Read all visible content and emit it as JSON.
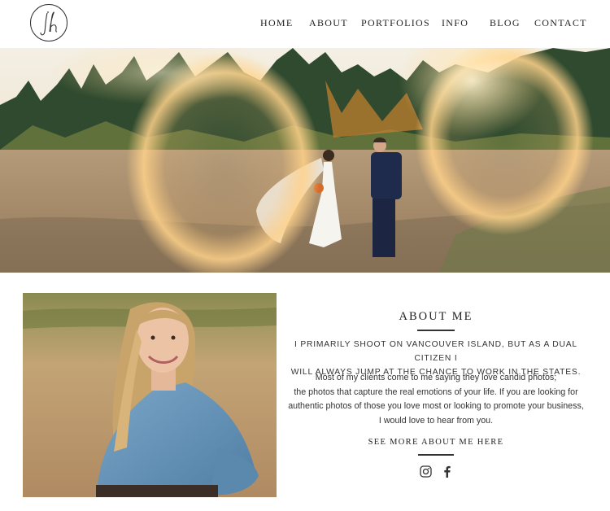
{
  "header": {
    "logo_icon": "jh-monogram-logo",
    "nav": [
      {
        "label": "HOME"
      },
      {
        "label": "ABOUT"
      },
      {
        "label": "PORTFOLIOS"
      },
      {
        "label": "INFO"
      },
      {
        "label": "BLOG"
      },
      {
        "label": "CONTACT"
      }
    ]
  },
  "hero": {
    "image": "wedding-couple-walking-in-meadow-with-sun-flare"
  },
  "about": {
    "photo": "portrait-of-woman-in-denim-shirt-in-field",
    "title": "ABOUT ME",
    "intro_line1": "I PRIMARILY SHOOT ON VANCOUVER ISLAND, BUT AS A DUAL CITIZEN I",
    "intro_line2": "WILL ALWAYS JUMP AT THE CHANCE TO WORK IN THE STATES.",
    "body_line1": "Most of my clients come to me saying they love candid photos;",
    "body_line2": "the photos that capture the real emotions of your life.  If you are looking for",
    "body_line3": "authentic photos of those you love most or looking to promote your business,",
    "body_line4": "I would love to hear from you.",
    "see_more": "SEE MORE ABOUT ME HERE",
    "social": [
      {
        "icon": "instagram-icon"
      },
      {
        "icon": "facebook-icon"
      }
    ]
  },
  "colors": {
    "text": "#222222",
    "background": "#ffffff"
  }
}
